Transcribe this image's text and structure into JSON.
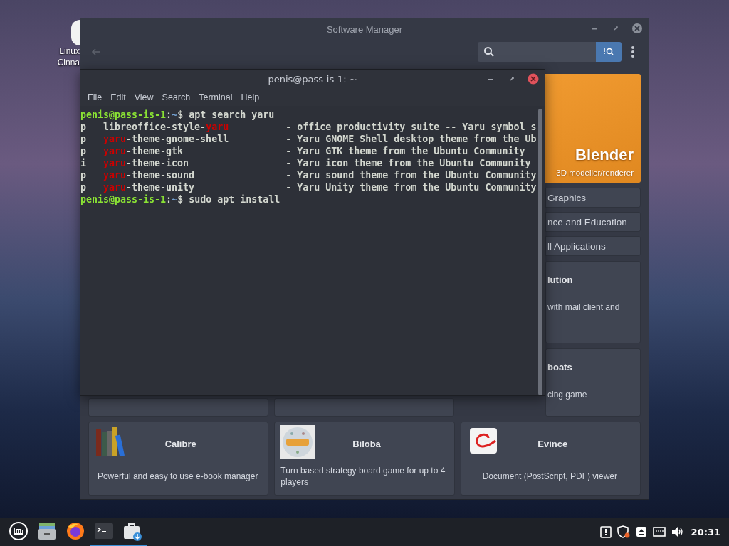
{
  "desktop": {
    "icon_label_lines": [
      "Linux",
      "Cinna"
    ]
  },
  "software_manager": {
    "title": "Software Manager",
    "featured": {
      "name": "Blender",
      "subtitle": "3D modeller/renderer"
    },
    "categories": [
      "Graphics",
      "nce and Education",
      "ll Applications"
    ],
    "cards": [
      {
        "title": "lution",
        "description": "with mail client and"
      },
      {
        "title": "boats",
        "description": "cing game"
      }
    ],
    "apps": [
      {
        "kind": "books",
        "name": "Calibre",
        "description": "Powerful and easy to use e-book manager"
      },
      {
        "kind": "ball",
        "name": "Biloba",
        "description": "Turn based strategy board game for up to 4 players"
      },
      {
        "kind": "document",
        "name": "Evince",
        "description": "Document (PostScript, PDF) viewer"
      }
    ]
  },
  "terminal": {
    "title": "penis@pass-is-1: ~",
    "menu": [
      "File",
      "Edit",
      "View",
      "Search",
      "Terminal",
      "Help"
    ],
    "lines": [
      {
        "kind": "prompt",
        "user": "penis@pass-is-1",
        "separator": ":",
        "path": "~",
        "symbol": "$",
        "command": "apt search yaru"
      },
      {
        "kind": "package",
        "status": "p",
        "name_parts": [
          {
            "text": "libreoffice-style-",
            "match": false
          },
          {
            "text": "yaru",
            "match": true
          }
        ],
        "description": "- office productivity suite -- Yaru symbol s"
      },
      {
        "kind": "package",
        "status": "p",
        "name_parts": [
          {
            "text": "yaru",
            "match": true
          },
          {
            "text": "-theme-gnome-shell",
            "match": false
          }
        ],
        "description": "- Yaru GNOME Shell desktop theme from the Ub"
      },
      {
        "kind": "package",
        "status": "p",
        "name_parts": [
          {
            "text": "yaru",
            "match": true
          },
          {
            "text": "-theme-gtk",
            "match": false
          }
        ],
        "description": "- Yaru GTK theme from the Ubuntu Community"
      },
      {
        "kind": "package",
        "status": "i",
        "name_parts": [
          {
            "text": "yaru",
            "match": true
          },
          {
            "text": "-theme-icon",
            "match": false
          }
        ],
        "description": "- Yaru icon theme from the Ubuntu Community"
      },
      {
        "kind": "package",
        "status": "p",
        "name_parts": [
          {
            "text": "yaru",
            "match": true
          },
          {
            "text": "-theme-sound",
            "match": false
          }
        ],
        "description": "- Yaru sound theme from the Ubuntu Community"
      },
      {
        "kind": "package",
        "status": "p",
        "name_parts": [
          {
            "text": "yaru",
            "match": true
          },
          {
            "text": "-theme-unity",
            "match": false
          }
        ],
        "description": "- Yaru Unity theme from the Ubuntu Community"
      },
      {
        "kind": "prompt",
        "user": "penis@pass-is-1",
        "separator": ":",
        "path": "~",
        "symbol": "$",
        "command": "sudo apt install"
      }
    ]
  },
  "taskbar": {
    "apps": [
      {
        "kind": "files",
        "active": false
      },
      {
        "kind": "browser",
        "active": false
      },
      {
        "kind": "terminal",
        "active": true
      },
      {
        "kind": "software",
        "active": true
      }
    ],
    "clock": "20:31"
  }
}
